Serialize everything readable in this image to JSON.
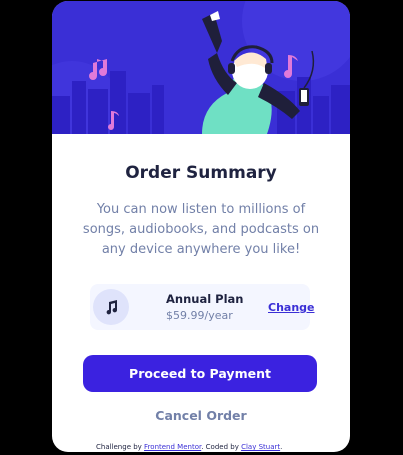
{
  "card": {
    "title": "Order Summary",
    "description": "You can now listen to millions of songs, audiobooks, and podcasts on any device anywhere you like!"
  },
  "plan": {
    "icon": "music-note-icon",
    "name": "Annual Plan",
    "price": "$59.99/year",
    "change_label": "Change"
  },
  "actions": {
    "proceed_label": "Proceed to Payment",
    "cancel_label": "Cancel Order"
  },
  "attribution": {
    "prefix": "Challenge by",
    "fm_link": "Frontend Mentor",
    "middle": ". Coded by",
    "author_link": "Clay Stuart",
    "suffix": "."
  },
  "colors": {
    "accent": "#3a2fd6",
    "button": "#3b22e0",
    "muted_text": "#7280a8",
    "dark_text": "#1f2340",
    "plan_bg": "#f4f6ff"
  }
}
